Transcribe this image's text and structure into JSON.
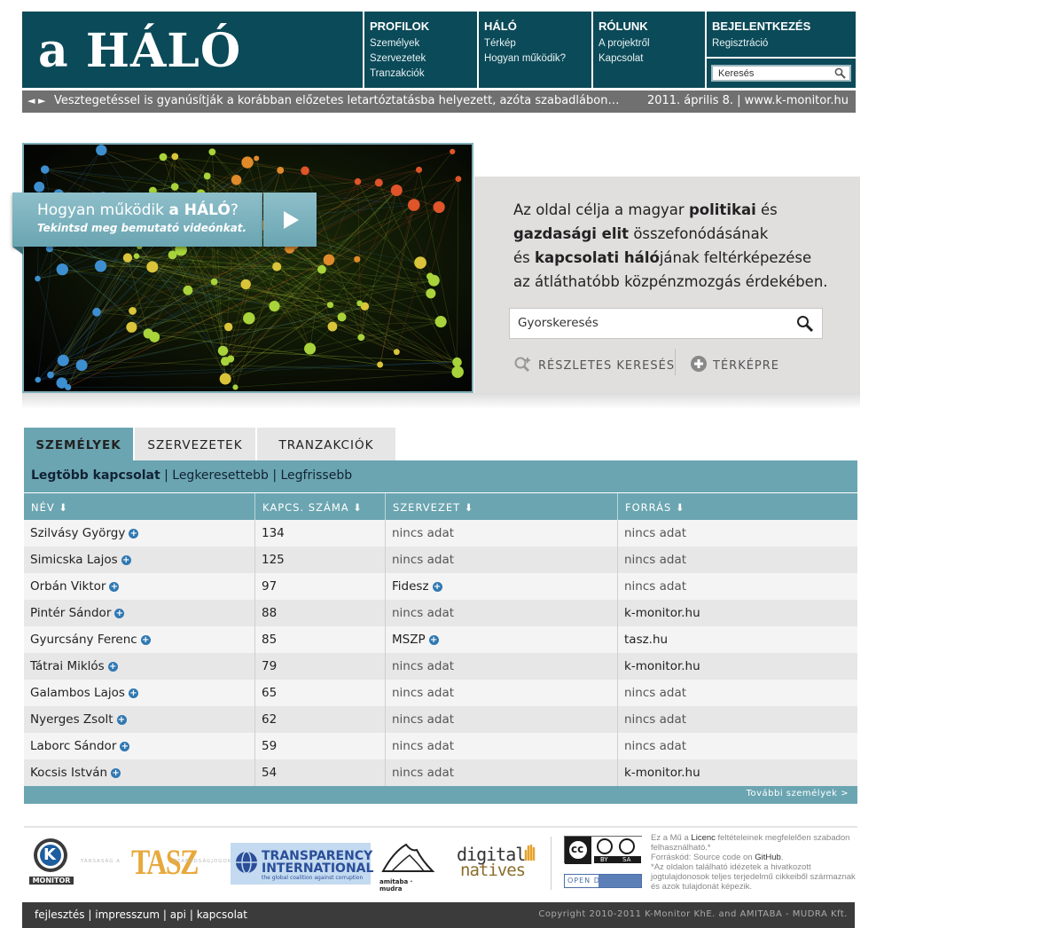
{
  "header": {
    "logo_prefix": "a",
    "logo_main": "HÁLÓ",
    "nav": [
      {
        "heading": "PROFILOK",
        "links": [
          "Személyek",
          "Szervezetek",
          "Tranzakciók"
        ]
      },
      {
        "heading": "HÁLÓ",
        "links": [
          "Térkép",
          "Hogyan működik?"
        ]
      },
      {
        "heading": "RÓLUNK",
        "links": [
          "A projektről",
          "Kapcsolat"
        ]
      }
    ],
    "login_label": "BEJELENTKEZÉS",
    "register_label": "Regisztráció",
    "search_placeholder": "Keresés"
  },
  "ticker": {
    "arrows": "◄ ►",
    "headline": "Vesztegetéssel is gyanúsítják a korábban előzetes letartóztatásba helyezett, azóta szabadlábon…",
    "date_source": "2011. április 8. | www.k-monitor.hu"
  },
  "hero": {
    "video_title_pre": "Hogyan működik",
    "video_title_bold": "a HÁLÓ",
    "video_title_post": "?",
    "video_subtitle": "Tekintsd meg bemutató videónkat.",
    "intro": {
      "p1": "Az oldal célja a magyar",
      "b1": "politikai",
      "p2": "és",
      "b2": "gazdasági elit",
      "p3": "összefonódásának",
      "p4": "és",
      "b3": "kapcsolati háló",
      "p5": "jának feltérképezése",
      "p6": "az átláthatóbb közpénzmozgás érdekében."
    },
    "quick_search_placeholder": "Gyorskeresés",
    "advanced_search_label": "RÉSZLETES KERESÉS",
    "map_label": "TÉRKÉPRE"
  },
  "tabs": [
    "SZEMÉLYEK",
    "SZERVEZETEK",
    "TRANZAKCIÓK"
  ],
  "active_tab": "SZEMÉLYEK",
  "subfilters": {
    "active": "Legtöbb kapcsolat",
    "others": [
      "Legkeresettebb",
      "Legfrissebb"
    ],
    "separator": "|"
  },
  "table": {
    "columns": [
      "NÉV",
      "KAPCS. SZÁMA",
      "SZERVEZET",
      "FORRÁS"
    ],
    "rows": [
      {
        "name": "Szilvásy György",
        "count": "134",
        "org": "nincs adat",
        "org_link": false,
        "source": "nincs adat",
        "source_link": false
      },
      {
        "name": "Simicska Lajos",
        "count": "125",
        "org": "nincs adat",
        "org_link": false,
        "source": "nincs adat",
        "source_link": false
      },
      {
        "name": "Orbán Viktor",
        "count": "97",
        "org": "Fidesz",
        "org_link": true,
        "source": "nincs adat",
        "source_link": false
      },
      {
        "name": "Pintér Sándor",
        "count": "88",
        "org": "nincs adat",
        "org_link": false,
        "source": "k-monitor.hu",
        "source_link": true
      },
      {
        "name": "Gyurcsány Ferenc",
        "count": "85",
        "org": "MSZP",
        "org_link": true,
        "source": "tasz.hu",
        "source_link": true
      },
      {
        "name": "Tátrai Miklós",
        "count": "79",
        "org": "nincs adat",
        "org_link": false,
        "source": "k-monitor.hu",
        "source_link": true
      },
      {
        "name": "Galambos Lajos",
        "count": "65",
        "org": "nincs adat",
        "org_link": false,
        "source": "nincs adat",
        "source_link": false
      },
      {
        "name": "Nyerges Zsolt",
        "count": "62",
        "org": "nincs adat",
        "org_link": false,
        "source": "nincs adat",
        "source_link": false
      },
      {
        "name": "Laborc Sándor",
        "count": "59",
        "org": "nincs adat",
        "org_link": false,
        "source": "nincs adat",
        "source_link": false
      },
      {
        "name": "Kocsis István",
        "count": "54",
        "org": "nincs adat",
        "org_link": false,
        "source": "k-monitor.hu",
        "source_link": true
      }
    ],
    "more_label": "További személyek >"
  },
  "partners": {
    "kmonitor_label": "MONITOR",
    "kmonitor_letter": "K",
    "tasz_label": "TASZ",
    "tasz_side_left": "TÁRSASÁG A",
    "tasz_side_right": "SZABADSÁGJOGOKÉRT",
    "ti_line1": "TRANSPARENCY",
    "ti_line2": "INTERNATIONAL",
    "ti_line3": "the global coalition against corruption",
    "amitaba_label": "amitaba · mudra",
    "dn_line1": "digital",
    "dn_line2": "natives",
    "cc_label": "cc",
    "cc_by": "BY",
    "cc_sa": "SA",
    "opendata_label": "OPEN DATA"
  },
  "license": {
    "line1_pre": "Ez a Mű a",
    "line1_link": "Licenc",
    "line1_post": "feltételeinek megfelelően szabadon felhasználható.*",
    "line2_pre": "Forráskód: Source code on",
    "line2_link": "GitHub",
    "line2_post": ".",
    "line3": "*Az oldalon található idézetek a hivatkozott jogtulajdonosok teljes terjedelmű cikkeiből származnak és azok tulajdonát képezik."
  },
  "footer": {
    "links": [
      "fejlesztés",
      "impresszum",
      "api",
      "kapcsolat"
    ],
    "copyright": "Copyright 2010-2011 K-Monitor KhE. and AMITABA - MUDRA Kft."
  },
  "colors": {
    "primary": "#0b4a58",
    "teal": "#6ba5b1",
    "ticker": "#707070",
    "footer": "#3b3b3b",
    "plus_icon": "#2f78b2"
  }
}
